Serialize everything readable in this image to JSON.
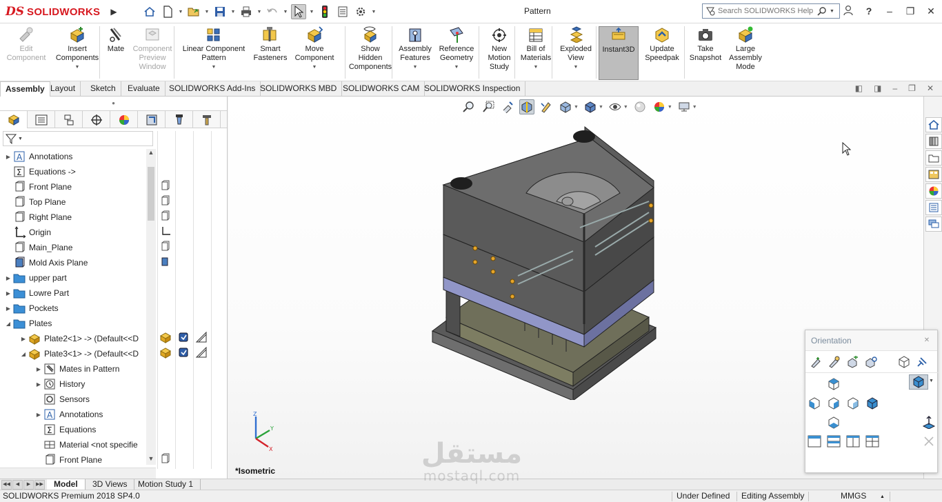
{
  "app": {
    "logo_ds": "DS",
    "logo_name": "SOLIDWORKS",
    "document_title": "Pattern",
    "search_placeholder": "Search SOLIDWORKS Help",
    "help": "?"
  },
  "ribbon": {
    "buttons": [
      {
        "label": "Edit\nComponent",
        "icon": "edit-component-icon",
        "disabled": true
      },
      {
        "label": "Insert\nComponents",
        "icon": "insert-components-icon"
      },
      {
        "label": "Mate",
        "icon": "mate-icon"
      },
      {
        "label": "Component\nPreview\nWindow",
        "icon": "preview-window-icon",
        "disabled": true
      },
      {
        "label": "Linear Component\nPattern",
        "icon": "linear-pattern-icon"
      },
      {
        "label": "Smart\nFasteners",
        "icon": "smart-fasteners-icon"
      },
      {
        "label": "Move\nComponent",
        "icon": "move-component-icon"
      },
      {
        "label": "Show\nHidden\nComponents",
        "icon": "show-hidden-icon"
      },
      {
        "label": "Assembly\nFeatures",
        "icon": "assembly-features-icon"
      },
      {
        "label": "Reference\nGeometry",
        "icon": "reference-geometry-icon"
      },
      {
        "label": "New\nMotion\nStudy",
        "icon": "motion-study-icon"
      },
      {
        "label": "Bill of\nMaterials",
        "icon": "bom-icon"
      },
      {
        "label": "Exploded\nView",
        "icon": "exploded-view-icon"
      },
      {
        "label": "Instant3D",
        "icon": "instant3d-icon",
        "active": true
      },
      {
        "label": "Update\nSpeedpak",
        "icon": "speedpak-icon"
      },
      {
        "label": "Take\nSnapshot",
        "icon": "snapshot-icon"
      },
      {
        "label": "Large\nAssembly\nMode",
        "icon": "large-assembly-icon"
      }
    ]
  },
  "tabs": [
    "Assembly",
    "Layout",
    "Sketch",
    "Evaluate",
    "SOLIDWORKS Add-Ins",
    "SOLIDWORKS MBD",
    "SOLIDWORKS CAM",
    "SOLIDWORKS Inspection"
  ],
  "tree": {
    "items": [
      {
        "label": "Annotations",
        "icon": "annotations-icon",
        "expander": "collapsed",
        "indent": 0
      },
      {
        "label": "Equations ->",
        "icon": "equations-icon",
        "expander": "none",
        "indent": 0
      },
      {
        "label": "Front Plane",
        "icon": "plane-icon",
        "expander": "none",
        "indent": 0
      },
      {
        "label": "Top Plane",
        "icon": "plane-icon",
        "expander": "none",
        "indent": 0
      },
      {
        "label": "Right Plane",
        "icon": "plane-icon",
        "expander": "none",
        "indent": 0
      },
      {
        "label": "Origin",
        "icon": "origin-icon",
        "expander": "none",
        "indent": 0
      },
      {
        "label": "Main_Plane",
        "icon": "plane-icon",
        "expander": "none",
        "indent": 0
      },
      {
        "label": "Mold Axis Plane",
        "icon": "plane-blue-icon",
        "expander": "none",
        "indent": 0
      },
      {
        "label": "upper part",
        "icon": "folder-icon",
        "expander": "collapsed",
        "indent": 0
      },
      {
        "label": "Lowre Part",
        "icon": "folder-icon",
        "expander": "collapsed",
        "indent": 0
      },
      {
        "label": "Pockets",
        "icon": "folder-icon",
        "expander": "collapsed",
        "indent": 0
      },
      {
        "label": "Plates",
        "icon": "folder-icon",
        "expander": "expanded",
        "indent": 0
      },
      {
        "label": "Plate2<1> -> (Default<<D",
        "icon": "part-icon",
        "expander": "collapsed",
        "indent": 1
      },
      {
        "label": "Plate3<1> -> (Default<<D",
        "icon": "part-icon",
        "expander": "expanded",
        "indent": 1
      },
      {
        "label": "Mates in Pattern",
        "icon": "mates-icon",
        "expander": "collapsed",
        "indent": 2
      },
      {
        "label": "History",
        "icon": "history-icon",
        "expander": "collapsed",
        "indent": 2
      },
      {
        "label": "Sensors",
        "icon": "sensors-icon",
        "expander": "none",
        "indent": 2
      },
      {
        "label": "Annotations",
        "icon": "annotations-icon",
        "expander": "collapsed",
        "indent": 2
      },
      {
        "label": "Equations",
        "icon": "equations-icon",
        "expander": "none",
        "indent": 2
      },
      {
        "label": "Material <not specifie",
        "icon": "material-icon",
        "expander": "none",
        "indent": 2
      },
      {
        "label": "Front Plane",
        "icon": "plane-icon",
        "expander": "none",
        "indent": 2
      }
    ]
  },
  "graphics": {
    "view_label": "*Isometric",
    "triad": {
      "x": "X",
      "y": "Y",
      "z": "Z"
    }
  },
  "orientation": {
    "title": "Orientation"
  },
  "bottom_tabs": [
    "Model",
    "3D Views",
    "Motion Study 1"
  ],
  "status": {
    "product": "SOLIDWORKS Premium 2018 SP4.0",
    "state": "Under Defined",
    "mode": "Editing Assembly",
    "units": "MMGS"
  },
  "watermark": {
    "arabic": "مستقل",
    "latin": "mostaql.com"
  },
  "colors": {
    "brand": "#d71920",
    "plate_blue": "#8a8fc0",
    "steel": "#6b6b6b"
  }
}
